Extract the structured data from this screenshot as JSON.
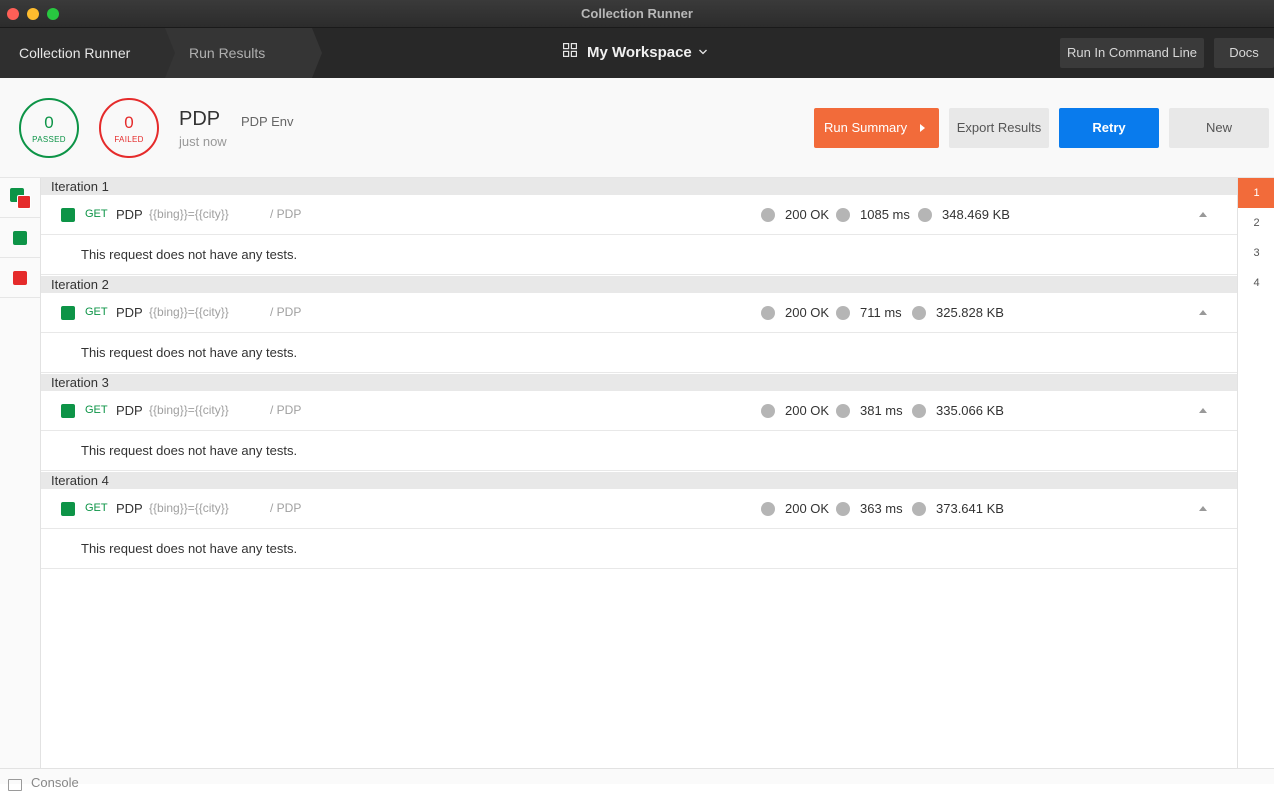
{
  "window": {
    "title": "Collection Runner"
  },
  "header": {
    "breadcrumbs": [
      "Collection Runner",
      "Run Results"
    ],
    "workspace": "My Workspace",
    "run_cli_label": "Run In Command Line",
    "docs_label": "Docs"
  },
  "summary": {
    "passed_count": "0",
    "passed_label": "PASSED",
    "failed_count": "0",
    "failed_label": "FAILED",
    "collection_name": "PDP",
    "environment": "PDP Env",
    "time": "just now",
    "buttons": {
      "run_summary": "Run Summary",
      "export": "Export Results",
      "retry": "Retry",
      "new": "New"
    }
  },
  "iterations": [
    {
      "title": "Iteration 1",
      "method": "GET",
      "name": "PDP",
      "url": "{{bing}}={{city}}",
      "path": "/ PDP",
      "status": "200 OK",
      "time": "1085 ms",
      "size": "348.469 KB",
      "tests": "This request does not have any tests."
    },
    {
      "title": "Iteration 2",
      "method": "GET",
      "name": "PDP",
      "url": "{{bing}}={{city}}",
      "path": "/ PDP",
      "status": "200 OK",
      "time": "711 ms",
      "size": "325.828 KB",
      "tests": "This request does not have any tests."
    },
    {
      "title": "Iteration 3",
      "method": "GET",
      "name": "PDP",
      "url": "{{bing}}={{city}}",
      "path": "/ PDP",
      "status": "200 OK",
      "time": "381 ms",
      "size": "335.066 KB",
      "tests": "This request does not have any tests."
    },
    {
      "title": "Iteration 4",
      "method": "GET",
      "name": "PDP",
      "url": "{{bing}}={{city}}",
      "path": "/ PDP",
      "status": "200 OK",
      "time": "363 ms",
      "size": "373.641 KB",
      "tests": "This request does not have any tests."
    }
  ],
  "iteration_nav": [
    "1",
    "2",
    "3",
    "4"
  ],
  "console": {
    "label": "Console"
  },
  "colors": {
    "pass": "#0d9447",
    "fail": "#e52b2b",
    "accent": "#f26b3a",
    "primary": "#097bed"
  }
}
